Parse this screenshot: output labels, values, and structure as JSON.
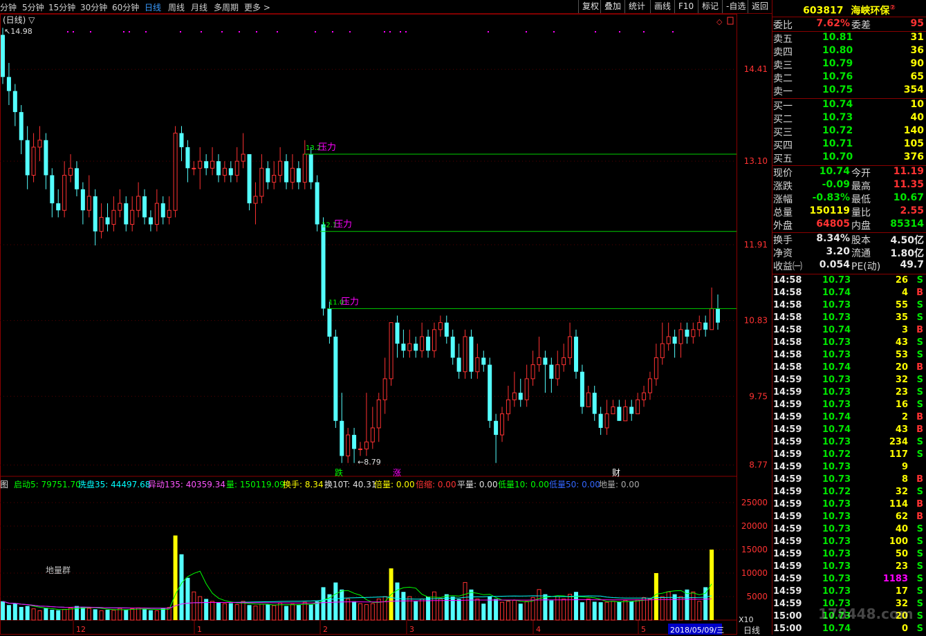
{
  "toolbar": {
    "periods": [
      "分钟",
      "5分钟",
      "15分钟",
      "30分钟",
      "60分钟",
      "日线",
      "周线",
      "月线",
      "多周期",
      "更多 >"
    ],
    "active_period": "日线",
    "buttons": [
      "复权",
      "叠加",
      "统计",
      "画线",
      "F10",
      "标记",
      "-自选",
      "返回"
    ]
  },
  "chart": {
    "title": "(日线) ▽",
    "high_label": "14.98",
    "low_label": "8.79",
    "price_axis": [
      "14.41",
      "13.10",
      "11.91",
      "10.83",
      "9.75",
      "8.77"
    ],
    "resistance_lines": [
      {
        "label": "13.2",
        "text": "压力",
        "value": 13.2
      },
      {
        "label": "12.1",
        "text": "压力",
        "value": 12.1
      },
      {
        "label": "11.0",
        "text": "压力",
        "value": 11.0
      }
    ],
    "markers": [
      {
        "text": "跌",
        "color": "#00ff00"
      },
      {
        "text": "涨",
        "color": "#ff00ff"
      },
      {
        "text": "财",
        "color": "#ffffff"
      }
    ],
    "indicator_bar": [
      {
        "text": "启动5: 79751.70",
        "color": "#00ff00"
      },
      {
        "text": "洗盘35: 44497.68",
        "color": "#00ffff"
      },
      {
        "text": "异动135: 40359.34",
        "color": "#ff55ff"
      },
      {
        "text": "量: 150119.09",
        "color": "#00ff00"
      },
      {
        "text": "换手: 8.34",
        "color": "#ffff00"
      },
      {
        "text": "换10T: 40.31",
        "color": "#e0e0e0"
      },
      {
        "text": "倍量: 0.00",
        "color": "#ffff00"
      },
      {
        "text": "倍缩: 0.00",
        "color": "#ff3333"
      },
      {
        "text": "平量: 0.00",
        "color": "#e0e0e0"
      },
      {
        "text": "低量10: 0.00",
        "color": "#00ff00"
      },
      {
        "text": "低量50: 0.00",
        "color": "#3366ff"
      },
      {
        "text": "地量: 0.00",
        "color": "#aaaaaa"
      }
    ],
    "indicator_prefix": "图",
    "volume_axis": [
      "25000",
      "20000",
      "15000",
      "10000",
      "5000"
    ],
    "volume_unit": "X10",
    "ground_volume_label": "地量群",
    "date_axis": [
      {
        "text": "12"
      },
      {
        "text": "1"
      },
      {
        "text": "2"
      },
      {
        "text": "3"
      },
      {
        "text": "4"
      },
      {
        "text": "5"
      }
    ],
    "cursor_date": "2018/05/09/三",
    "period_label": "日线"
  },
  "chart_data": {
    "type": "candlestick",
    "price_ylim": [
      8.6,
      15.2
    ],
    "candles": [
      [
        14.9,
        14.3,
        15.0,
        14.2
      ],
      [
        14.3,
        14.1,
        14.5,
        13.9
      ],
      [
        14.1,
        13.8,
        14.2,
        13.6
      ],
      [
        13.8,
        13.4,
        13.9,
        13.2
      ],
      [
        13.4,
        12.9,
        13.6,
        12.7
      ],
      [
        12.9,
        13.3,
        13.5,
        12.8
      ],
      [
        13.3,
        13.4,
        13.6,
        13.1
      ],
      [
        13.4,
        12.9,
        13.5,
        12.7
      ],
      [
        12.9,
        12.5,
        13.0,
        12.3
      ],
      [
        12.5,
        12.4,
        12.7,
        12.3
      ],
      [
        12.4,
        12.9,
        13.1,
        12.3
      ],
      [
        12.9,
        13.0,
        13.2,
        12.8
      ],
      [
        13.0,
        12.7,
        13.1,
        12.6
      ],
      [
        12.7,
        12.4,
        12.8,
        12.2
      ],
      [
        12.4,
        12.6,
        12.9,
        12.3
      ],
      [
        12.6,
        12.1,
        12.7,
        11.9
      ],
      [
        12.1,
        12.3,
        12.5,
        12.0
      ],
      [
        12.3,
        12.2,
        12.5,
        12.1
      ],
      [
        12.2,
        12.4,
        12.6,
        12.1
      ],
      [
        12.4,
        12.5,
        12.7,
        12.3
      ],
      [
        12.5,
        12.2,
        12.6,
        12.1
      ],
      [
        12.2,
        12.4,
        12.6,
        12.1
      ],
      [
        12.4,
        12.6,
        12.8,
        12.3
      ],
      [
        12.6,
        12.3,
        12.7,
        12.2
      ],
      [
        12.3,
        12.2,
        12.4,
        12.1
      ],
      [
        12.2,
        12.5,
        12.7,
        12.1
      ],
      [
        12.5,
        12.3,
        12.6,
        12.2
      ],
      [
        12.3,
        12.4,
        12.6,
        12.2
      ],
      [
        12.4,
        13.5,
        13.6,
        12.3
      ],
      [
        13.5,
        13.3,
        13.6,
        13.1
      ],
      [
        13.3,
        13.0,
        13.4,
        12.8
      ],
      [
        13.0,
        13.0,
        13.1,
        12.9
      ],
      [
        13.0,
        13.1,
        13.3,
        12.7
      ],
      [
        13.1,
        13.0,
        13.2,
        12.9
      ],
      [
        13.0,
        13.1,
        13.3,
        12.9
      ],
      [
        13.1,
        12.9,
        13.2,
        12.8
      ],
      [
        12.9,
        13.0,
        13.1,
        12.8
      ],
      [
        13.0,
        12.9,
        13.1,
        12.8
      ],
      [
        12.9,
        13.1,
        13.3,
        12.8
      ],
      [
        13.1,
        13.2,
        13.5,
        13.0
      ],
      [
        13.2,
        12.5,
        13.2,
        12.4
      ],
      [
        12.5,
        12.6,
        12.8,
        12.2
      ],
      [
        12.6,
        13.0,
        13.2,
        12.5
      ],
      [
        13.0,
        12.8,
        13.1,
        12.7
      ],
      [
        12.8,
        12.9,
        13.1,
        12.7
      ],
      [
        12.9,
        13.1,
        13.3,
        12.8
      ],
      [
        13.1,
        12.8,
        13.2,
        12.7
      ],
      [
        12.8,
        13.0,
        13.2,
        12.7
      ],
      [
        13.0,
        12.8,
        13.1,
        12.7
      ],
      [
        12.8,
        13.2,
        13.4,
        12.7
      ],
      [
        13.2,
        12.8,
        13.3,
        12.7
      ],
      [
        12.8,
        12.2,
        12.9,
        12.1
      ],
      [
        12.2,
        11.0,
        12.3,
        10.9
      ],
      [
        11.0,
        10.6,
        11.1,
        10.5
      ],
      [
        10.6,
        9.4,
        10.7,
        9.3
      ],
      [
        9.4,
        8.9,
        9.8,
        8.8
      ],
      [
        8.9,
        9.2,
        9.3,
        8.8
      ],
      [
        9.2,
        9.0,
        9.3,
        8.8
      ],
      [
        9.0,
        9.0,
        9.1,
        8.9
      ],
      [
        9.0,
        9.1,
        9.8,
        8.9
      ],
      [
        9.1,
        9.3,
        9.6,
        9.0
      ],
      [
        9.3,
        9.7,
        9.8,
        9.1
      ],
      [
        9.7,
        10.0,
        10.3,
        9.5
      ],
      [
        10.0,
        10.8,
        10.8,
        9.9
      ],
      [
        10.8,
        10.5,
        10.9,
        10.3
      ],
      [
        10.5,
        10.4,
        10.7,
        10.3
      ],
      [
        10.4,
        10.5,
        10.7,
        10.3
      ],
      [
        10.5,
        10.4,
        10.6,
        10.3
      ],
      [
        10.4,
        10.6,
        10.8,
        10.3
      ],
      [
        10.6,
        10.4,
        10.7,
        10.3
      ],
      [
        10.4,
        10.7,
        10.8,
        10.3
      ],
      [
        10.7,
        10.8,
        10.9,
        10.6
      ],
      [
        10.8,
        10.6,
        10.9,
        10.5
      ],
      [
        10.6,
        10.3,
        10.7,
        10.2
      ],
      [
        10.3,
        10.1,
        10.5,
        10.0
      ],
      [
        10.1,
        10.6,
        10.7,
        10.0
      ],
      [
        10.6,
        10.1,
        10.7,
        10.0
      ],
      [
        10.1,
        10.3,
        10.5,
        10.0
      ],
      [
        10.3,
        10.2,
        10.4,
        10.1
      ],
      [
        10.2,
        9.4,
        10.3,
        9.3
      ],
      [
        9.4,
        9.2,
        9.5,
        8.8
      ],
      [
        9.2,
        9.5,
        9.6,
        9.1
      ],
      [
        9.5,
        9.7,
        9.9,
        9.4
      ],
      [
        9.7,
        9.8,
        10.1,
        9.6
      ],
      [
        9.8,
        9.7,
        10.0,
        9.6
      ],
      [
        9.7,
        10.0,
        10.2,
        9.6
      ],
      [
        10.0,
        10.2,
        10.4,
        9.9
      ],
      [
        10.2,
        10.3,
        10.6,
        10.1
      ],
      [
        10.3,
        10.2,
        10.4,
        9.8
      ],
      [
        10.2,
        10.0,
        10.3,
        9.8
      ],
      [
        10.0,
        10.2,
        10.4,
        9.9
      ],
      [
        10.2,
        10.3,
        10.5,
        10.1
      ],
      [
        10.3,
        10.6,
        10.8,
        10.2
      ],
      [
        10.6,
        10.1,
        10.7,
        10.0
      ],
      [
        10.1,
        9.6,
        10.2,
        9.5
      ],
      [
        9.6,
        9.8,
        9.9,
        9.6
      ],
      [
        9.8,
        9.5,
        9.9,
        9.4
      ],
      [
        9.5,
        9.3,
        9.6,
        9.2
      ],
      [
        9.3,
        9.5,
        9.7,
        9.2
      ],
      [
        9.5,
        9.6,
        9.7,
        9.5
      ],
      [
        9.6,
        9.4,
        9.7,
        9.4
      ],
      [
        9.4,
        9.6,
        9.7,
        9.4
      ],
      [
        9.6,
        9.5,
        9.7,
        9.4
      ],
      [
        9.5,
        9.7,
        9.8,
        9.5
      ],
      [
        9.7,
        9.8,
        9.9,
        9.6
      ],
      [
        9.8,
        10.0,
        10.1,
        9.7
      ],
      [
        10.0,
        10.3,
        10.5,
        9.9
      ],
      [
        10.3,
        10.5,
        10.8,
        10.2
      ],
      [
        10.5,
        10.6,
        10.8,
        10.4
      ],
      [
        10.6,
        10.5,
        10.7,
        10.3
      ],
      [
        10.5,
        10.7,
        10.8,
        10.3
      ],
      [
        10.7,
        10.6,
        10.8,
        10.5
      ],
      [
        10.6,
        10.7,
        10.8,
        10.5
      ],
      [
        10.7,
        10.8,
        10.9,
        10.6
      ],
      [
        10.8,
        10.7,
        10.9,
        10.6
      ],
      [
        10.7,
        11.0,
        11.3,
        10.7
      ],
      [
        11.0,
        10.8,
        11.2,
        10.7
      ]
    ],
    "volumes": [
      4000,
      3200,
      3500,
      2800,
      3000,
      2400,
      2000,
      2600,
      2200,
      2100,
      2300,
      2600,
      3000,
      2800,
      2500,
      2300,
      2000,
      2200,
      2100,
      2500,
      2200,
      2400,
      2600,
      2300,
      2100,
      2000,
      2500,
      2700,
      18000,
      14000,
      9000,
      6000,
      5000,
      4500,
      4000,
      3800,
      3500,
      3600,
      3300,
      4000,
      3200,
      3000,
      3400,
      3300,
      3100,
      3600,
      3000,
      3400,
      3200,
      3800,
      3300,
      4000,
      7000,
      5500,
      8000,
      6500,
      4500,
      4000,
      3500,
      3300,
      3500,
      4500,
      5000,
      11000,
      8000,
      6000,
      5000,
      4000,
      4500,
      5000,
      6000,
      4500,
      5500,
      5000,
      4500,
      8000,
      6500,
      4500,
      3500,
      5000,
      4500,
      3800,
      4000,
      4200,
      3500,
      4000,
      4800,
      6500,
      5500,
      4200,
      5000,
      4500,
      5500,
      6000,
      3800,
      4500,
      3900,
      3800,
      3800,
      4000,
      3900,
      4200,
      4000,
      4300,
      4800,
      4500,
      10000,
      5000,
      6000,
      5500,
      5000,
      6500,
      6000,
      4000,
      7000,
      15000
    ]
  },
  "right_panel": {
    "code": "603817",
    "name": "海峡环保",
    "name_mark": "②",
    "weibi": {
      "label": "委比",
      "value": "7.62%",
      "label2": "委差",
      "value2": "95"
    },
    "sells": [
      {
        "label": "卖五",
        "price": "10.81",
        "vol": "31"
      },
      {
        "label": "卖四",
        "price": "10.80",
        "vol": "36"
      },
      {
        "label": "卖三",
        "price": "10.79",
        "vol": "90"
      },
      {
        "label": "卖二",
        "price": "10.76",
        "vol": "65"
      },
      {
        "label": "卖一",
        "price": "10.75",
        "vol": "354"
      }
    ],
    "buys": [
      {
        "label": "买一",
        "price": "10.74",
        "vol": "10"
      },
      {
        "label": "买二",
        "price": "10.73",
        "vol": "40"
      },
      {
        "label": "买三",
        "price": "10.72",
        "vol": "140"
      },
      {
        "label": "买四",
        "price": "10.71",
        "vol": "105"
      },
      {
        "label": "买五",
        "price": "10.70",
        "vol": "376"
      }
    ],
    "quotes": [
      {
        "l1": "现价",
        "v1": "10.74",
        "c1": "grn",
        "l2": "今开",
        "v2": "11.19",
        "c2": "red"
      },
      {
        "l1": "涨跌",
        "v1": "-0.09",
        "c1": "grn",
        "l2": "最高",
        "v2": "11.35",
        "c2": "red"
      },
      {
        "l1": "涨幅",
        "v1": "-0.83%",
        "c1": "grn",
        "l2": "最低",
        "v2": "10.67",
        "c2": "grn"
      },
      {
        "l1": "总量",
        "v1": "150119",
        "c1": "yel",
        "l2": "量比",
        "v2": "2.55",
        "c2": "red"
      },
      {
        "l1": "外盘",
        "v1": "64805",
        "c1": "red",
        "l2": "内盘",
        "v2": "85314",
        "c2": "grn"
      }
    ],
    "finance": [
      {
        "l1": "换手",
        "v1": "8.34%",
        "l2": "股本",
        "v2": "4.50亿"
      },
      {
        "l1": "净资",
        "v1": "3.20",
        "l2": "流通",
        "v2": "1.80亿"
      },
      {
        "l1": "收益㈠",
        "v1": "0.054",
        "l2": "PE(动)",
        "v2": "49.7"
      }
    ],
    "ticks": [
      [
        "14:58",
        "10.73",
        "26",
        "S"
      ],
      [
        "14:58",
        "10.74",
        "4",
        "B"
      ],
      [
        "14:58",
        "10.73",
        "55",
        "S"
      ],
      [
        "14:58",
        "10.73",
        "35",
        "S"
      ],
      [
        "14:58",
        "10.74",
        "3",
        "B"
      ],
      [
        "14:58",
        "10.73",
        "43",
        "S"
      ],
      [
        "14:58",
        "10.73",
        "53",
        "S"
      ],
      [
        "14:58",
        "10.74",
        "20",
        "B"
      ],
      [
        "14:59",
        "10.73",
        "32",
        "S"
      ],
      [
        "14:59",
        "10.73",
        "23",
        "S"
      ],
      [
        "14:59",
        "10.73",
        "16",
        "S"
      ],
      [
        "14:59",
        "10.74",
        "2",
        "B"
      ],
      [
        "14:59",
        "10.74",
        "43",
        "B"
      ],
      [
        "14:59",
        "10.73",
        "234",
        "S"
      ],
      [
        "14:59",
        "10.72",
        "117",
        "S"
      ],
      [
        "14:59",
        "10.73",
        "9",
        ""
      ],
      [
        "14:59",
        "10.73",
        "8",
        "B"
      ],
      [
        "14:59",
        "10.72",
        "32",
        "S"
      ],
      [
        "14:59",
        "10.73",
        "114",
        "B"
      ],
      [
        "14:59",
        "10.73",
        "62",
        "B"
      ],
      [
        "14:59",
        "10.73",
        "40",
        "S"
      ],
      [
        "14:59",
        "10.73",
        "100",
        "S"
      ],
      [
        "14:59",
        "10.73",
        "50",
        "S"
      ],
      [
        "14:59",
        "10.73",
        "23",
        "S"
      ],
      [
        "14:59",
        "10.73",
        "1183",
        "S"
      ],
      [
        "14:59",
        "10.73",
        "17",
        "S"
      ],
      [
        "14:59",
        "10.73",
        "32",
        "S"
      ],
      [
        "15:00",
        "10.73",
        "20",
        "S"
      ],
      [
        "15:00",
        "10.74",
        "0",
        "S"
      ]
    ],
    "watermark": "178448.com"
  }
}
